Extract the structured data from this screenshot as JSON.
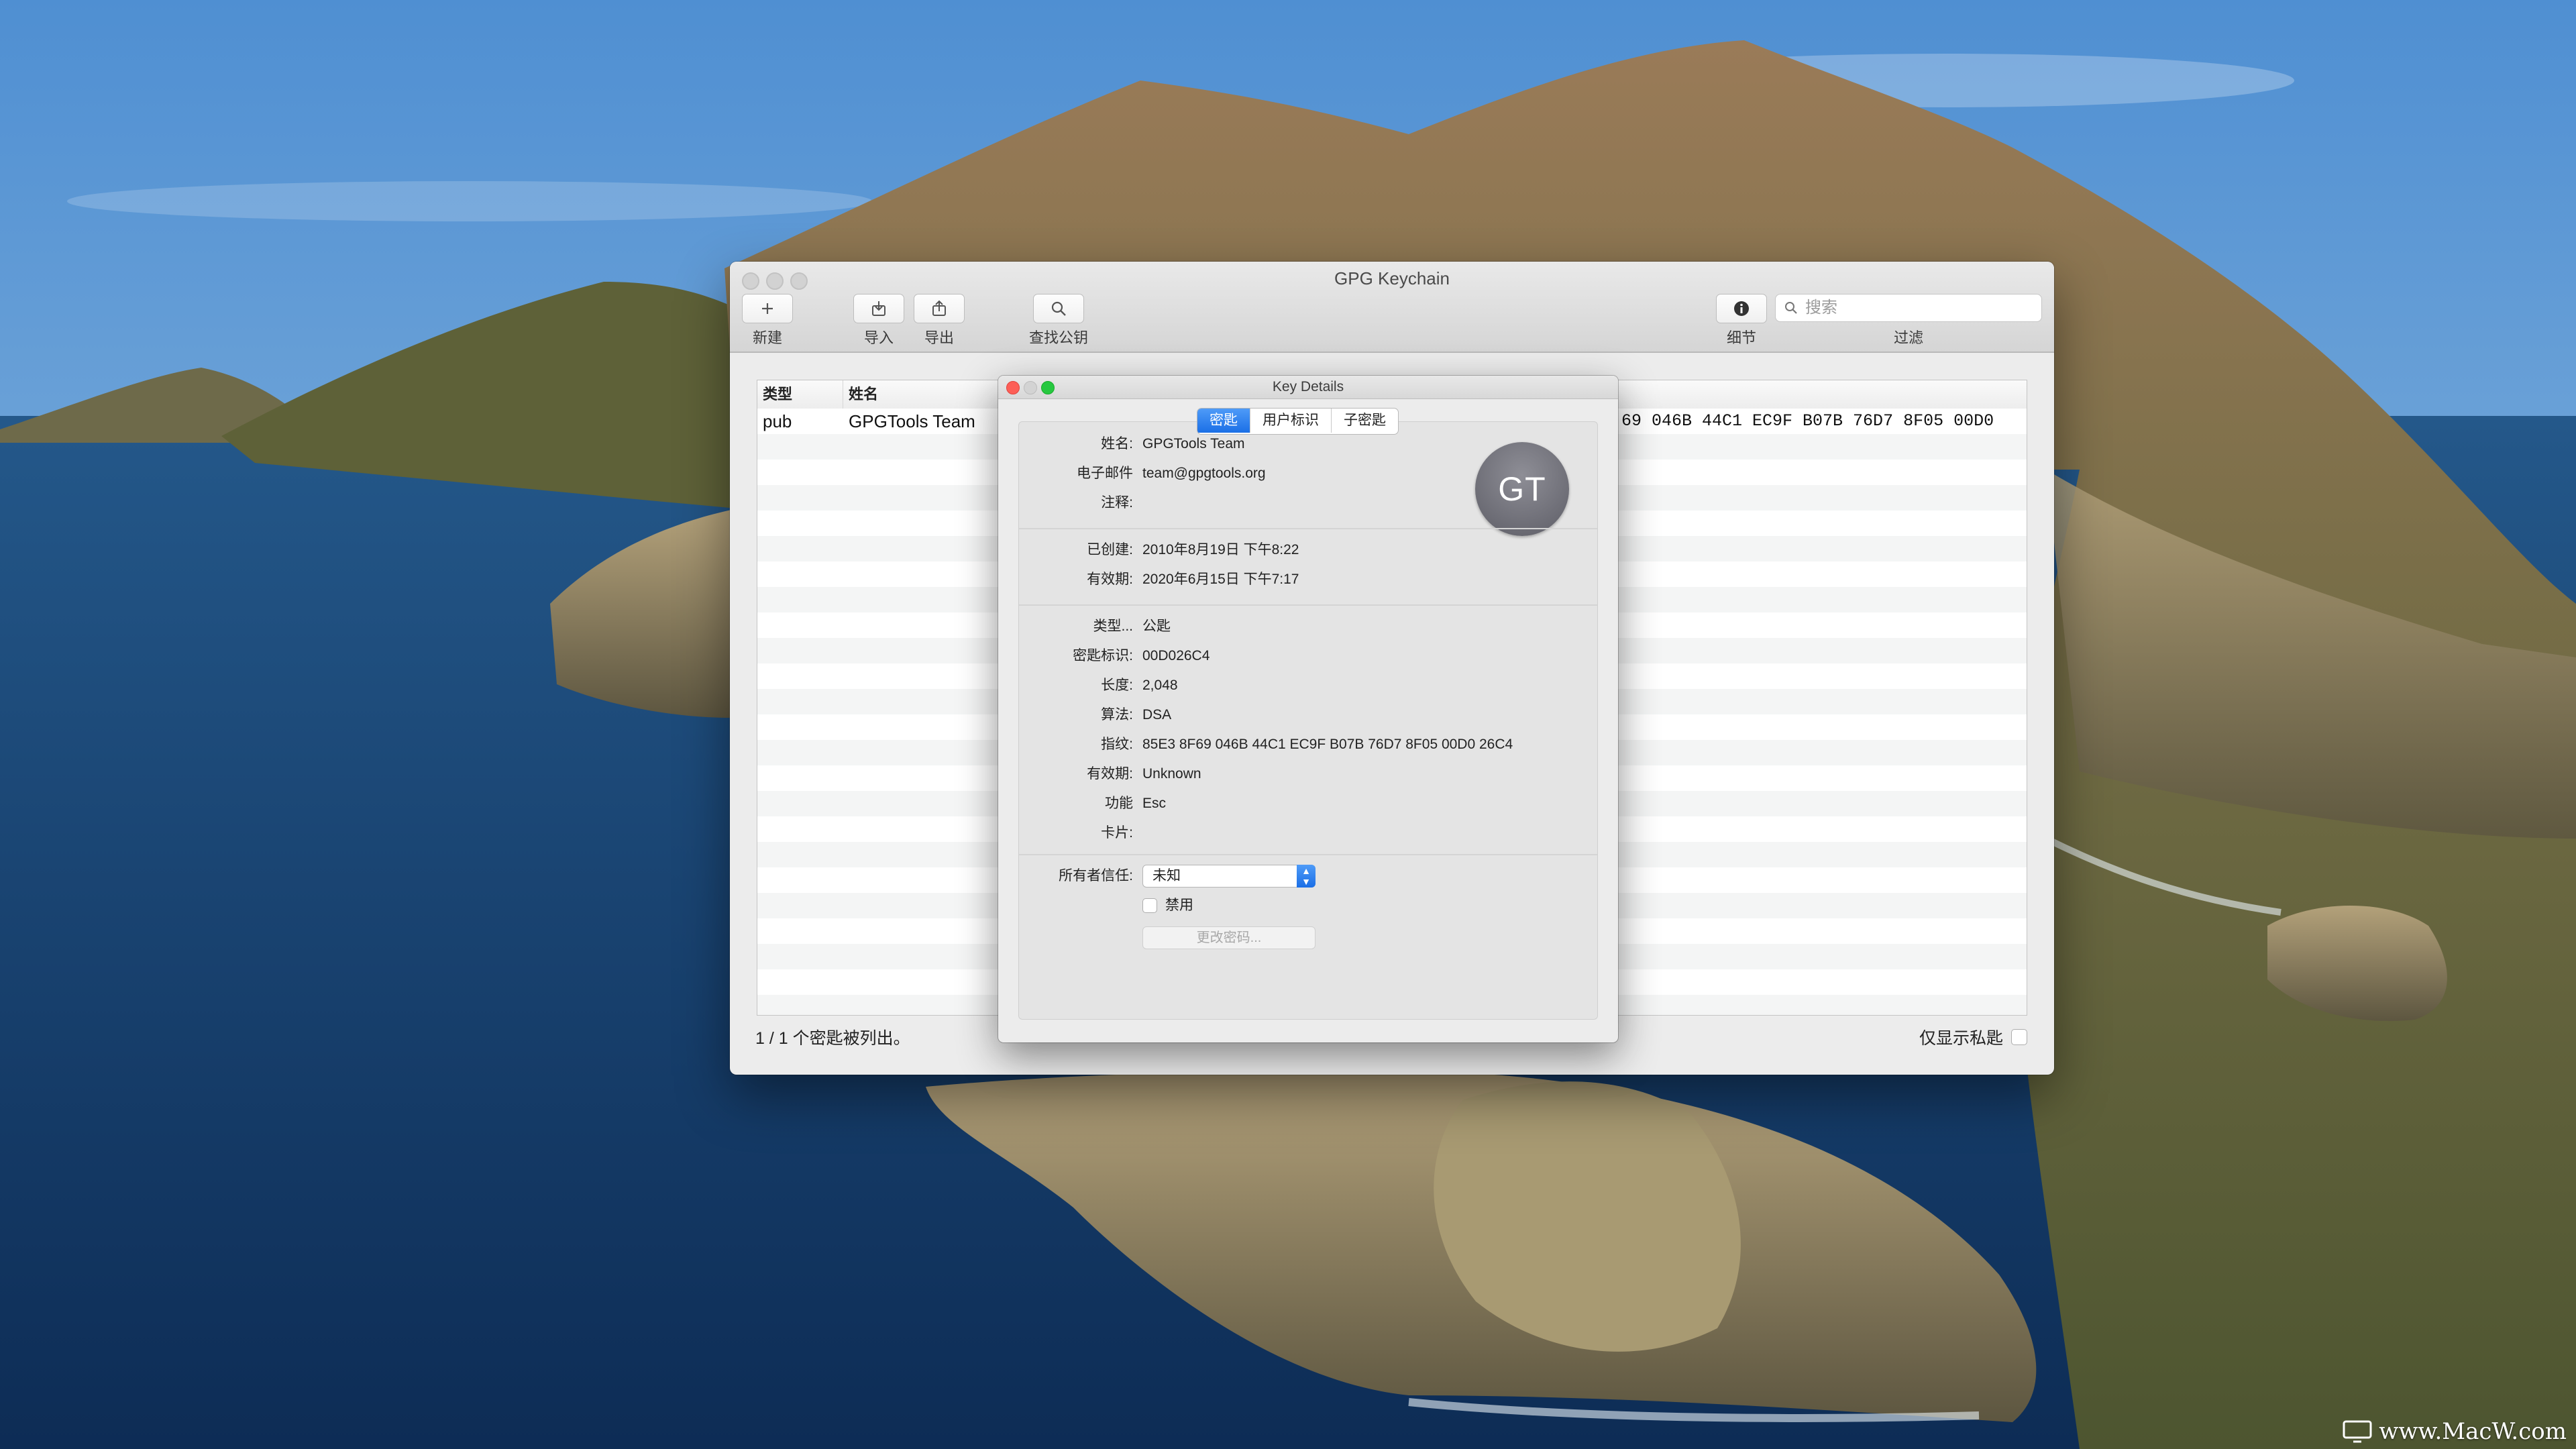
{
  "main_window": {
    "title": "GPG Keychain",
    "toolbar": {
      "new_label": "新建",
      "import_label": "导入",
      "export_label": "导出",
      "lookup_label": "查找公钥",
      "details_label": "细节",
      "filter_label": "过滤",
      "search_placeholder": "搜索"
    },
    "table": {
      "columns": [
        "类型",
        "姓名"
      ],
      "rows": [
        {
          "type": "pub",
          "name": "GPGTools Team",
          "fingerprint_tail": "69 046B 44C1 EC9F  B07B 76D7 8F05 00D0"
        }
      ]
    },
    "status_text": "1 / 1 个密匙被列出。",
    "secret_only_label": "仅显示私匙"
  },
  "key_details": {
    "title": "Key Details",
    "tabs": [
      "密匙",
      "用户标识",
      "子密匙"
    ],
    "active_tab": 0,
    "avatar_initials": "GT",
    "fields": {
      "name_label": "姓名:",
      "name": "GPGTools Team",
      "email_label": "电子邮件",
      "email": "team@gpgtools.org",
      "comment_label": "注释:",
      "comment": "",
      "created_label": "已创建:",
      "created": "2010年8月19日 下午8:22",
      "expires_label": "有效期:",
      "expires": "2020年6月15日 下午7:17",
      "type_label": "类型...",
      "type": "公匙",
      "keyid_label": "密匙标识:",
      "keyid": "00D026C4",
      "length_label": "长度:",
      "length": "2,048",
      "algorithm_label": "算法:",
      "algorithm": "DSA",
      "fingerprint_label": "指纹:",
      "fingerprint": "85E3 8F69 046B 44C1 EC9F  B07B 76D7 8F05 00D0 26C4",
      "validity_label": "有效期:",
      "validity": "Unknown",
      "capabilities_label": "功能",
      "capabilities": "Esc",
      "card_label": "卡片:",
      "card": ""
    },
    "owner_trust_label": "所有者信任:",
    "owner_trust_value": "未知",
    "disable_label": "禁用",
    "change_password_label": "更改密码..."
  },
  "watermark": "www.MacW.com",
  "colors": {
    "accent": "#1b6fe6",
    "close": "#fd5f57",
    "minimize": "#d3d3d3",
    "zoom": "#27c840"
  },
  "icons": [
    "plus-icon",
    "import-icon",
    "export-icon",
    "magnifier-icon",
    "info-icon",
    "search-icon"
  ]
}
